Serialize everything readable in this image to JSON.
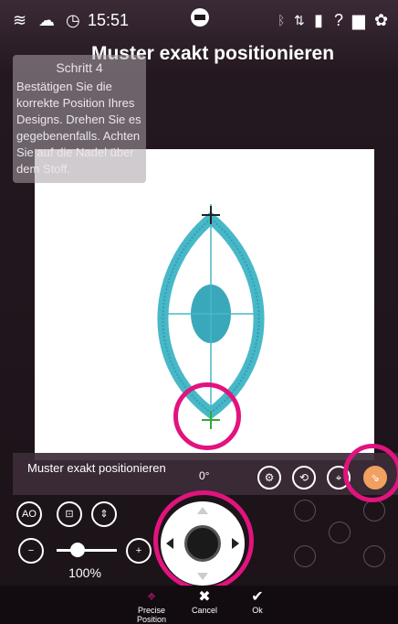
{
  "statusbar": {
    "time": "15:51",
    "icons_left": [
      "wifi-icon",
      "cloud-icon",
      "clock-icon"
    ],
    "icons_right": [
      "bluetooth-icon",
      "usb-icon",
      "book-icon",
      "help-icon",
      "manual-icon",
      "settings-icon"
    ]
  },
  "header": {
    "title": "Muster exakt positionieren"
  },
  "hint": {
    "title": "Schritt 4",
    "text": "Bestätigen Sie die korrekte Position Ihres Designs. Drehen Sie es gegebenenfalls. Achten Sie auf die Nadel über dem Stoff."
  },
  "panel": {
    "label": "Muster exakt positionieren",
    "angle": "0°",
    "zoom": "100%",
    "zoom_level": 0.35
  },
  "footer": {
    "items": [
      {
        "label": "Precise Position",
        "icon": "precise-position-icon"
      },
      {
        "label": "Cancel",
        "icon": "close-icon"
      },
      {
        "label": "Ok",
        "icon": "check-icon"
      }
    ]
  },
  "colors": {
    "accent": "#e2137e",
    "embroidery": "#48b8c8",
    "active_button": "#f0a060"
  }
}
